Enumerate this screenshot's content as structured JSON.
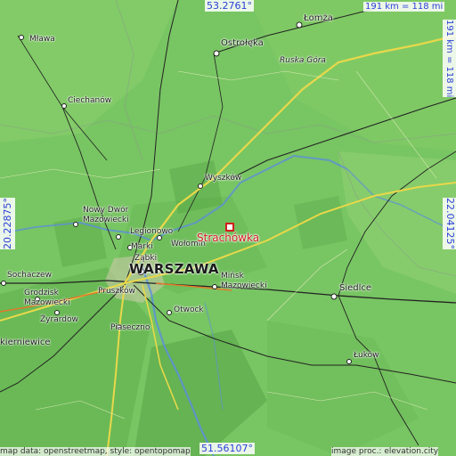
{
  "map": {
    "target": {
      "name": "Strachówka"
    },
    "coordinates": {
      "north": "53.2761°",
      "south": "51.56107°",
      "west": "20.22875°",
      "east": "22.04125°"
    },
    "scale": {
      "top": "191 km = 118 mi",
      "right": "191 km = 118 mi"
    },
    "credits": {
      "left": "map data: openstreetmap, style: opentopomap",
      "right": "image proc.: elevation.city"
    },
    "places": {
      "warszawa": "WARSZAWA",
      "lomza": "Łomża",
      "ostroleka": "Ostrołęka",
      "ruska_gora": "Ruska Góra",
      "mlawa": "Mława",
      "ciechanow": "Ciechanów",
      "wyszkow": "Wyszków",
      "nowy_dwor": "Nowy Dwór",
      "mazowiecki": "Mazowiecki",
      "legionowo": "Legionowo",
      "marki": "Marki",
      "wolomin": "Wołomin",
      "zabki": "Ząbki",
      "sochaczew": "Sochaczew",
      "grodzisk": "Grodzisk",
      "grodzisk_maz": "Mazowiecki",
      "pruszkow": "Pruszków",
      "zyrardow": "Żyrardów",
      "minsk": "Mińsk",
      "minsk_maz": "Mazowiecki",
      "siedlce": "Siedlce",
      "otwock": "Otwock",
      "piaseczno": "Piaseczno",
      "skierniewice": "kierniewice",
      "lukow": "Łuków"
    }
  }
}
